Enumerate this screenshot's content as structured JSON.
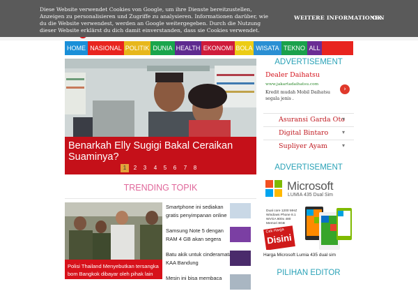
{
  "cookie": {
    "text": "Diese Website verwendet Cookies von Google, um ihre Dienste bereitzustellen, Anzeigen zu personalisieren und Zugriffe zu analysieren. Informationen darüber, wie du die Website verwendest, werden an Google weitergegeben. Durch die Nutzung dieser Website erklärst du dich damit einverstanden, dass sie Cookies verwendet.",
    "more_label": "WEITERE INFORMATIONEN",
    "ok_label": "OK"
  },
  "nav": {
    "items": [
      {
        "label": "HOME",
        "color": "#1a8fd8"
      },
      {
        "label": "NASIONAL",
        "color": "#e8241f"
      },
      {
        "label": "POLITIK",
        "color": "#e7b71c"
      },
      {
        "label": "DUNIA",
        "color": "#19a54c"
      },
      {
        "label": "HEALTH",
        "color": "#5e2a8f"
      },
      {
        "label": "EKONOMI",
        "color": "#cf1b3a"
      },
      {
        "label": "BOLA",
        "color": "#eccc15"
      },
      {
        "label": "WISATA",
        "color": "#2a8fd3"
      },
      {
        "label": "TEKNO",
        "color": "#1aa14b"
      },
      {
        "label": "ALL",
        "color": "#6b2c94"
      }
    ]
  },
  "slider": {
    "title": "Benarkah Elly Sugigi Bakal Ceraikan Suaminya?",
    "pages": [
      "1",
      "2",
      "3",
      "4",
      "5",
      "6",
      "7",
      "8"
    ],
    "active_page": "1"
  },
  "trending": {
    "heading": "TRENDING TOPIK",
    "main_caption": "Polisi Thailand Menyebutkan tersangka bom Bangkok dibayar oleh pihak lain",
    "items": [
      {
        "text": "Smartphone ini sediakan gratis penyimpanan online"
      },
      {
        "text": "Samsung Note 5 dengan RAM 4 GB akan segera"
      },
      {
        "text": "Batu akik untuk cinderamata KAA Bandung"
      },
      {
        "text": "Mesin ini bisa membaca"
      }
    ]
  },
  "sidebar": {
    "advert_heading": "ADVERTISEMENT",
    "ad": {
      "title": "Dealer Daihatsu",
      "url": "www.jakartadaihatsu.com",
      "desc": "Kredit mudah Mobil Daihatsu segala jenis ."
    },
    "ad_links": [
      {
        "label": "Asuransi Garda Oto"
      },
      {
        "label": "Digital Bintaro"
      },
      {
        "label": "Supliyer Ayam"
      }
    ],
    "advert_heading_2": "ADVERTISEMENT",
    "banner": {
      "brand": "Microsoft",
      "product": "LUMIA 435 Dual Sim",
      "specs": "Dual core 1200 MHZ Windows Phone 8.1 WVGA 800x 480 Memori 8GB",
      "cta_small": "Cek Harga",
      "cta_big": "Disini"
    },
    "banner_caption": "Harga Microsoft Lumia 435 dual sim",
    "editor_heading": "PILIHAN EDITOR"
  }
}
